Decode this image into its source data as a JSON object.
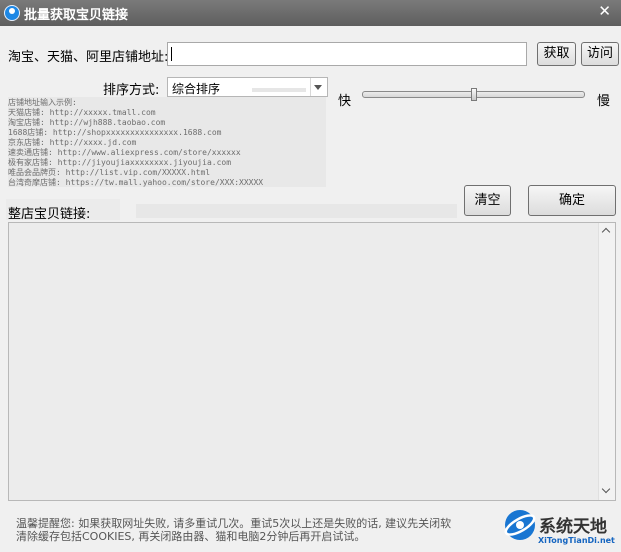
{
  "window": {
    "title": "批量获取宝贝链接",
    "close_label": "✕"
  },
  "shop_url": {
    "label": "淘宝、天猫、阿里店铺地址:",
    "value": ""
  },
  "buttons": {
    "fetch": "获取",
    "visit": "访问",
    "clear": "清空",
    "confirm": "确定"
  },
  "sort": {
    "label": "排序方式:",
    "selected": "综合排序"
  },
  "speed": {
    "fast_label": "快",
    "slow_label": "慢",
    "level_fraction": 0.5
  },
  "examples": {
    "heading": "店铺地址输入示例:",
    "lines": [
      "天猫店铺: http://xxxxx.tmall.com",
      "淘宝店铺: http://wjh888.taobao.com",
      "1688店铺: http://shopxxxxxxxxxxxxxxx.1688.com",
      "京东店铺: http://xxxx.jd.com",
      "速卖通店铺: http://www.aliexpress.com/store/xxxxxx",
      "极有家店铺: http://jiyoujiaxxxxxxxx.jiyoujia.com",
      "唯品会品牌页: http://list.vip.com/XXXXX.html",
      "台湾奇摩店铺: https://tw.mall.yahoo.com/store/XXX:XXXXX"
    ]
  },
  "links": {
    "label": "整店宝贝链接:"
  },
  "tips": [
    "温馨提醒您: 如果获取网址失败, 请多重试几次。重试5次以上还是失败的话, 建议先关闭软",
    "清除缓存包括COOKIES, 再关闭路由器、猫和电脑2分钟后再开启试试。"
  ],
  "watermark": {
    "title": "系统天地",
    "subtitle": "XiTongTianDi.net"
  }
}
